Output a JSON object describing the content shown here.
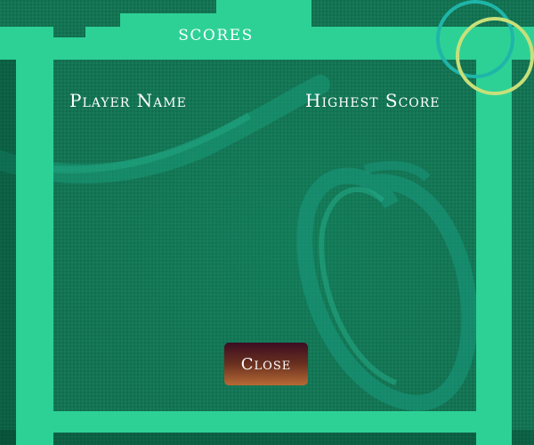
{
  "screen": {
    "title": "SCORES",
    "columns": {
      "player_name": "Player Name",
      "highest_score": "Highest Score"
    },
    "close_label": "Close"
  },
  "colors": {
    "background": "#0f7452",
    "frame": "#2dd196",
    "button_top": "#3b0d22",
    "button_bottom": "#b66a35",
    "ring_teal": "#1fb5a8",
    "ring_yellow": "#c7e07a"
  },
  "decorations": [
    "brush-stroke-swirl",
    "double-ring-ornament"
  ]
}
